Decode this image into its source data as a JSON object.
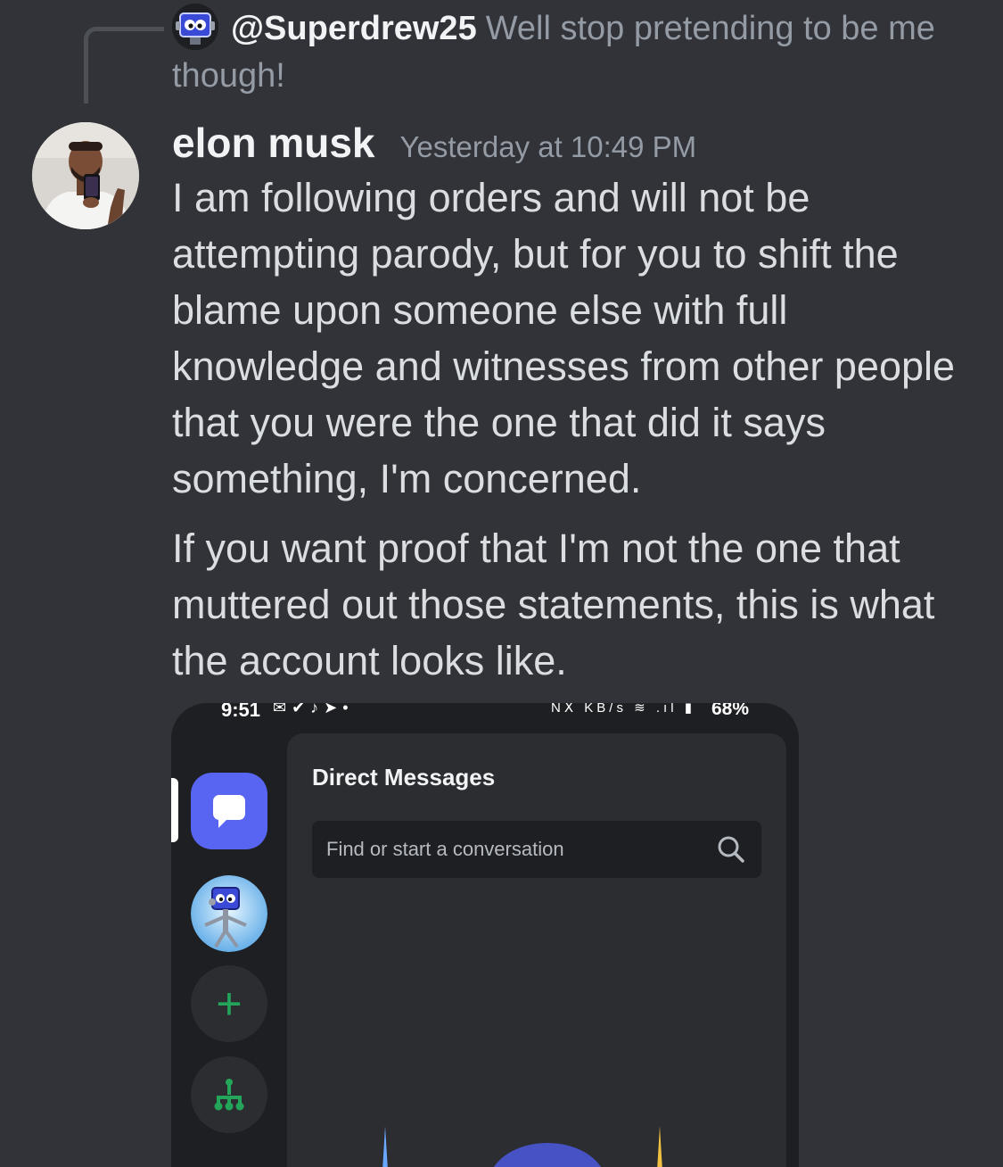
{
  "reply": {
    "username": "@Superdrew25",
    "text": "Well stop pretending to be me though!"
  },
  "message": {
    "author": "elon musk",
    "timestamp": "Yesterday at 10:49 PM",
    "paragraph_1": "I am following orders and will not be attempting parody, but for you to shift the blame upon someone else with full knowledge and witnesses from other people that you were the one that did it says something, I'm concerned.",
    "paragraph_2": "If you want proof that I'm not the one that muttered out those statements, this is what the account looks like."
  },
  "attachment": {
    "status_bar": {
      "time": "9:51",
      "network_speed": "KB/s",
      "battery": "68%"
    },
    "panel_title": "Direct Messages",
    "search_placeholder": "Find or start a conversation"
  },
  "colors": {
    "background": "#313338",
    "accent_blurple": "#5865f2",
    "green": "#23a55a"
  },
  "icons": [
    "reply-avatar-robot",
    "user-avatar-photo",
    "direct-messages-icon",
    "server-robot-icon",
    "add-server-icon",
    "discover-hub-icon",
    "search-icon"
  ]
}
